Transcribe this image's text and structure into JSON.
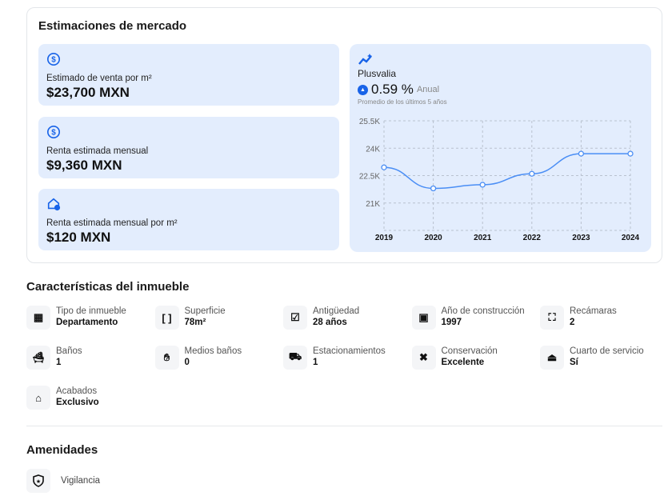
{
  "market": {
    "title": "Estimaciones de mercado",
    "stats": [
      {
        "icon": "dollar-circle-icon",
        "label": "Estimado de venta por m²",
        "value": "$23,700 MXN"
      },
      {
        "icon": "dollar-circle-icon",
        "label": "Renta estimada mensual",
        "value": "$9,360 MXN"
      },
      {
        "icon": "house-dollar-icon",
        "label": "Renta estimada mensual por m²",
        "value": "$120 MXN"
      }
    ],
    "plusvalia": {
      "title": "Plusvalia",
      "value": "0.59 %",
      "period": "Anual",
      "note": "Promedio de los últimos 5 años"
    }
  },
  "chart_data": {
    "type": "line",
    "x": [
      "2019",
      "2020",
      "2021",
      "2022",
      "2023",
      "2024"
    ],
    "values": [
      22950,
      21800,
      22000,
      22600,
      23700,
      23700
    ],
    "yticks": [
      "25.5K",
      "24K",
      "22.5K",
      "21K"
    ],
    "ytick_values": [
      25500,
      24000,
      22500,
      21000
    ],
    "ylim": [
      19500,
      25500
    ],
    "grid": true,
    "color": "#4a8ef5"
  },
  "features": {
    "title": "Características del inmueble",
    "items": [
      {
        "icon": "building-icon",
        "label": "Tipo de inmueble",
        "value": "Departamento"
      },
      {
        "icon": "brackets-icon",
        "label": "Superficie",
        "value": "78m²"
      },
      {
        "icon": "calendar-check-icon",
        "label": "Antigüedad",
        "value": "28 años"
      },
      {
        "icon": "calendar-icon",
        "label": "Año de construcción",
        "value": "1997"
      },
      {
        "icon": "bed-icon",
        "label": "Recámaras",
        "value": "2"
      },
      {
        "icon": "bathtub-icon",
        "label": "Baños",
        "value": "1"
      },
      {
        "icon": "hand-wash-icon",
        "label": "Medios baños",
        "value": "0"
      },
      {
        "icon": "car-icon",
        "label": "Estacionamientos",
        "value": "1"
      },
      {
        "icon": "tools-icon",
        "label": "Conservación",
        "value": "Excelente"
      },
      {
        "icon": "broom-icon",
        "label": "Cuarto de servicio",
        "value": "Sí"
      },
      {
        "icon": "house-icon",
        "label": "Acabados",
        "value": "Exclusivo"
      }
    ]
  },
  "amenities": {
    "title": "Amenidades",
    "items": [
      {
        "icon": "shield-star-icon",
        "label": "Vigilancia"
      }
    ]
  }
}
